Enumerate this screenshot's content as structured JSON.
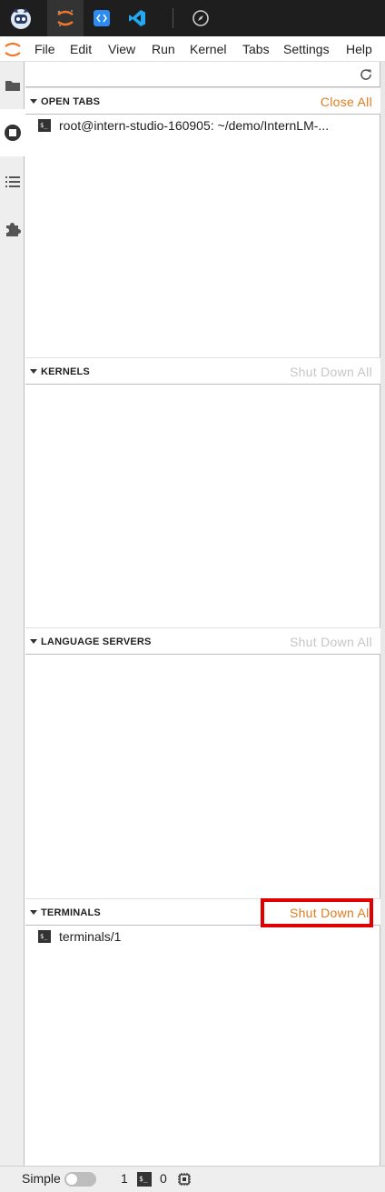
{
  "app": {
    "menu": [
      "File",
      "Edit",
      "View",
      "Run",
      "Kernel",
      "Tabs",
      "Settings",
      "Help"
    ],
    "accent_color": "#e07c1e",
    "highlight_color": "#e10000"
  },
  "topbar": {
    "icons": [
      "robot-mascot-icon",
      "jupyter-icon",
      "code-editor-icon",
      "vscode-icon",
      "compass-icon"
    ]
  },
  "sidebar": {
    "tabs": [
      "folder-icon",
      "stop-circle-icon",
      "list-icon",
      "puzzle-icon"
    ]
  },
  "sections": {
    "open_tabs": {
      "title": "OPEN TABS",
      "action": "Close All",
      "items": [
        "root@intern-studio-160905: ~/demo/InternLM-..."
      ]
    },
    "kernels": {
      "title": "KERNELS",
      "action": "Shut Down All",
      "items": []
    },
    "language_servers": {
      "title": "LANGUAGE SERVERS",
      "action": "Shut Down All",
      "items": []
    },
    "terminals": {
      "title": "TERMINALS",
      "action": "Shut Down All",
      "items": [
        "terminals/1"
      ]
    }
  },
  "statusbar": {
    "mode_label": "Simple",
    "simple_enabled": false,
    "terminal_count": "1",
    "kernel_count": "0"
  }
}
